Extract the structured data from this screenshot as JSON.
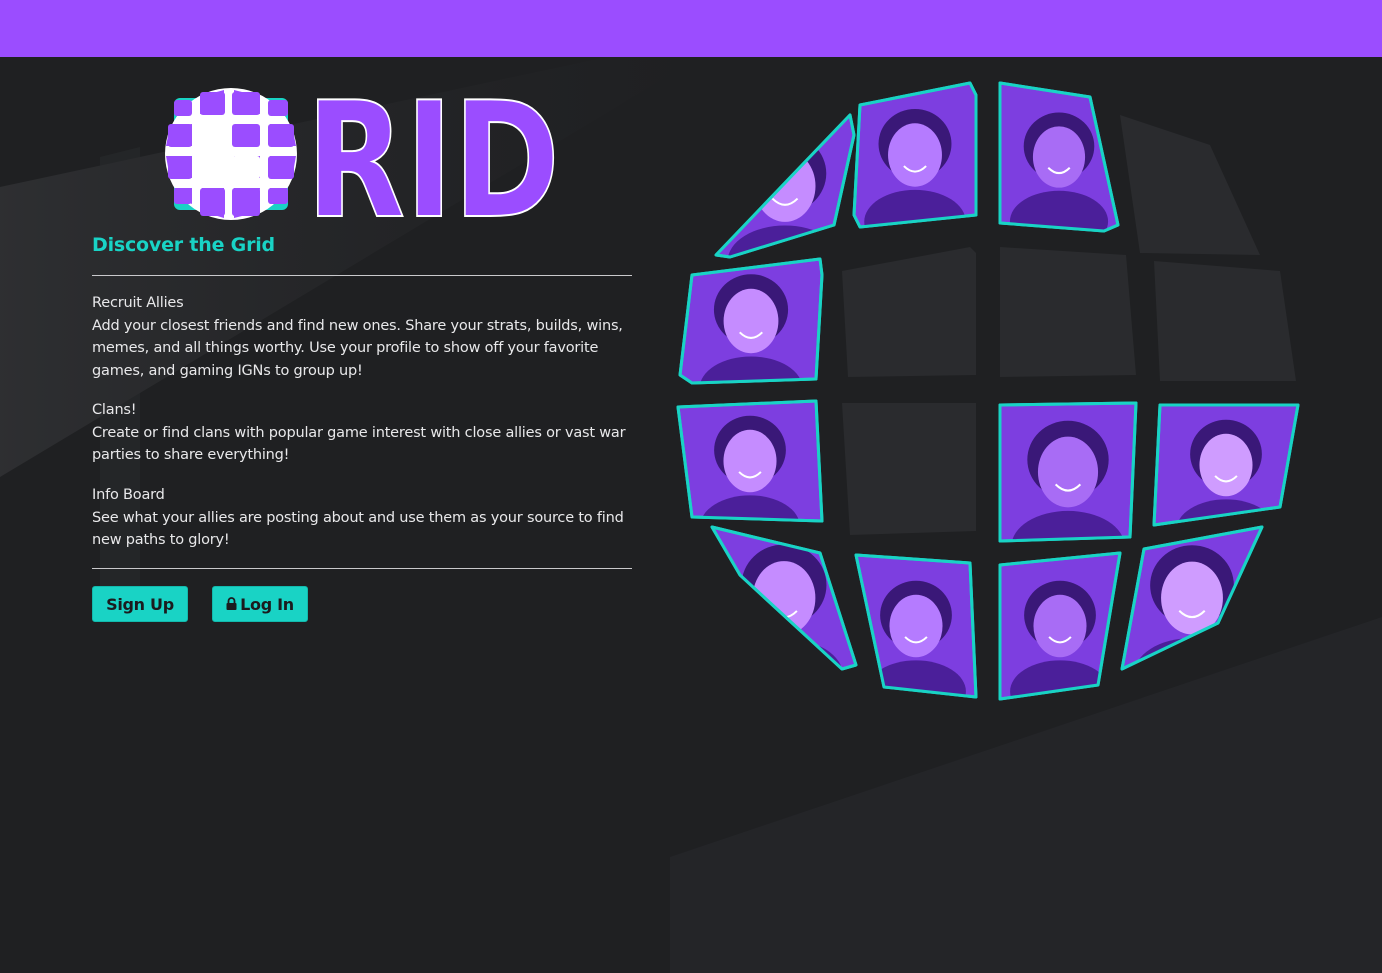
{
  "brand": {
    "logo_text": "RID",
    "tagline": "Discover the Grid",
    "accent": "#19d3c5",
    "brand_purple": "#9b4dff"
  },
  "sections": [
    {
      "title": "Recruit Allies",
      "body": "Add your closest friends and find new ones. Share your strats, builds, wins, memes, and all things worthy. Use your profile to show off your favorite games, and gaming IGNs to group up!"
    },
    {
      "title": "Clans!",
      "body": "Create or find clans with popular game interest with close allies or vast war parties to share everything!"
    },
    {
      "title": "Info Board",
      "body": "See what your allies are posting about and use them as your source to find new paths to glory!"
    }
  ],
  "actions": {
    "signup_label": "Sign Up",
    "login_label": "Log In",
    "login_icon": "lock-icon"
  },
  "globe": {
    "tiles": [
      {
        "row": 0,
        "col": 0,
        "photo": true
      },
      {
        "row": 0,
        "col": 1,
        "photo": true
      },
      {
        "row": 0,
        "col": 2,
        "photo": true
      },
      {
        "row": 0,
        "col": 3,
        "photo": false
      },
      {
        "row": 1,
        "col": 0,
        "photo": true
      },
      {
        "row": 1,
        "col": 1,
        "photo": false
      },
      {
        "row": 1,
        "col": 2,
        "photo": false
      },
      {
        "row": 1,
        "col": 3,
        "photo": false
      },
      {
        "row": 2,
        "col": 0,
        "photo": true
      },
      {
        "row": 2,
        "col": 1,
        "photo": false
      },
      {
        "row": 2,
        "col": 2,
        "photo": true
      },
      {
        "row": 2,
        "col": 3,
        "photo": true
      },
      {
        "row": 3,
        "col": 0,
        "photo": true
      },
      {
        "row": 3,
        "col": 1,
        "photo": true
      },
      {
        "row": 3,
        "col": 2,
        "photo": true
      },
      {
        "row": 3,
        "col": 3,
        "photo": true
      }
    ]
  }
}
